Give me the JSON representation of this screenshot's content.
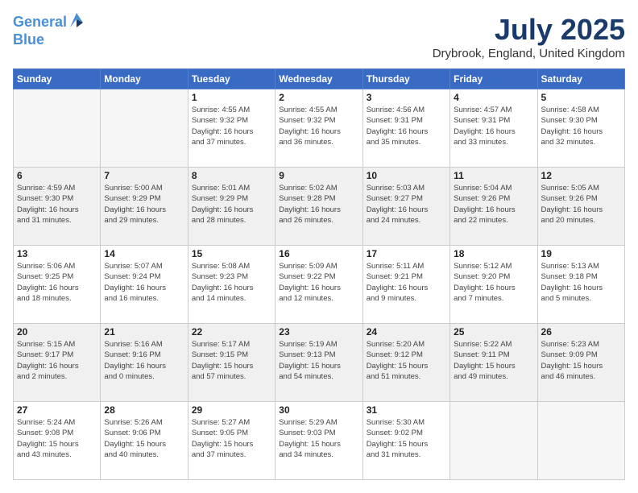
{
  "header": {
    "logo_line1": "General",
    "logo_line2": "Blue",
    "month": "July 2025",
    "location": "Drybrook, England, United Kingdom"
  },
  "days_of_week": [
    "Sunday",
    "Monday",
    "Tuesday",
    "Wednesday",
    "Thursday",
    "Friday",
    "Saturday"
  ],
  "weeks": [
    [
      {
        "day": "",
        "info": ""
      },
      {
        "day": "",
        "info": ""
      },
      {
        "day": "1",
        "info": "Sunrise: 4:55 AM\nSunset: 9:32 PM\nDaylight: 16 hours\nand 37 minutes."
      },
      {
        "day": "2",
        "info": "Sunrise: 4:55 AM\nSunset: 9:32 PM\nDaylight: 16 hours\nand 36 minutes."
      },
      {
        "day": "3",
        "info": "Sunrise: 4:56 AM\nSunset: 9:31 PM\nDaylight: 16 hours\nand 35 minutes."
      },
      {
        "day": "4",
        "info": "Sunrise: 4:57 AM\nSunset: 9:31 PM\nDaylight: 16 hours\nand 33 minutes."
      },
      {
        "day": "5",
        "info": "Sunrise: 4:58 AM\nSunset: 9:30 PM\nDaylight: 16 hours\nand 32 minutes."
      }
    ],
    [
      {
        "day": "6",
        "info": "Sunrise: 4:59 AM\nSunset: 9:30 PM\nDaylight: 16 hours\nand 31 minutes."
      },
      {
        "day": "7",
        "info": "Sunrise: 5:00 AM\nSunset: 9:29 PM\nDaylight: 16 hours\nand 29 minutes."
      },
      {
        "day": "8",
        "info": "Sunrise: 5:01 AM\nSunset: 9:29 PM\nDaylight: 16 hours\nand 28 minutes."
      },
      {
        "day": "9",
        "info": "Sunrise: 5:02 AM\nSunset: 9:28 PM\nDaylight: 16 hours\nand 26 minutes."
      },
      {
        "day": "10",
        "info": "Sunrise: 5:03 AM\nSunset: 9:27 PM\nDaylight: 16 hours\nand 24 minutes."
      },
      {
        "day": "11",
        "info": "Sunrise: 5:04 AM\nSunset: 9:26 PM\nDaylight: 16 hours\nand 22 minutes."
      },
      {
        "day": "12",
        "info": "Sunrise: 5:05 AM\nSunset: 9:26 PM\nDaylight: 16 hours\nand 20 minutes."
      }
    ],
    [
      {
        "day": "13",
        "info": "Sunrise: 5:06 AM\nSunset: 9:25 PM\nDaylight: 16 hours\nand 18 minutes."
      },
      {
        "day": "14",
        "info": "Sunrise: 5:07 AM\nSunset: 9:24 PM\nDaylight: 16 hours\nand 16 minutes."
      },
      {
        "day": "15",
        "info": "Sunrise: 5:08 AM\nSunset: 9:23 PM\nDaylight: 16 hours\nand 14 minutes."
      },
      {
        "day": "16",
        "info": "Sunrise: 5:09 AM\nSunset: 9:22 PM\nDaylight: 16 hours\nand 12 minutes."
      },
      {
        "day": "17",
        "info": "Sunrise: 5:11 AM\nSunset: 9:21 PM\nDaylight: 16 hours\nand 9 minutes."
      },
      {
        "day": "18",
        "info": "Sunrise: 5:12 AM\nSunset: 9:20 PM\nDaylight: 16 hours\nand 7 minutes."
      },
      {
        "day": "19",
        "info": "Sunrise: 5:13 AM\nSunset: 9:18 PM\nDaylight: 16 hours\nand 5 minutes."
      }
    ],
    [
      {
        "day": "20",
        "info": "Sunrise: 5:15 AM\nSunset: 9:17 PM\nDaylight: 16 hours\nand 2 minutes."
      },
      {
        "day": "21",
        "info": "Sunrise: 5:16 AM\nSunset: 9:16 PM\nDaylight: 16 hours\nand 0 minutes."
      },
      {
        "day": "22",
        "info": "Sunrise: 5:17 AM\nSunset: 9:15 PM\nDaylight: 15 hours\nand 57 minutes."
      },
      {
        "day": "23",
        "info": "Sunrise: 5:19 AM\nSunset: 9:13 PM\nDaylight: 15 hours\nand 54 minutes."
      },
      {
        "day": "24",
        "info": "Sunrise: 5:20 AM\nSunset: 9:12 PM\nDaylight: 15 hours\nand 51 minutes."
      },
      {
        "day": "25",
        "info": "Sunrise: 5:22 AM\nSunset: 9:11 PM\nDaylight: 15 hours\nand 49 minutes."
      },
      {
        "day": "26",
        "info": "Sunrise: 5:23 AM\nSunset: 9:09 PM\nDaylight: 15 hours\nand 46 minutes."
      }
    ],
    [
      {
        "day": "27",
        "info": "Sunrise: 5:24 AM\nSunset: 9:08 PM\nDaylight: 15 hours\nand 43 minutes."
      },
      {
        "day": "28",
        "info": "Sunrise: 5:26 AM\nSunset: 9:06 PM\nDaylight: 15 hours\nand 40 minutes."
      },
      {
        "day": "29",
        "info": "Sunrise: 5:27 AM\nSunset: 9:05 PM\nDaylight: 15 hours\nand 37 minutes."
      },
      {
        "day": "30",
        "info": "Sunrise: 5:29 AM\nSunset: 9:03 PM\nDaylight: 15 hours\nand 34 minutes."
      },
      {
        "day": "31",
        "info": "Sunrise: 5:30 AM\nSunset: 9:02 PM\nDaylight: 15 hours\nand 31 minutes."
      },
      {
        "day": "",
        "info": ""
      },
      {
        "day": "",
        "info": ""
      }
    ]
  ]
}
